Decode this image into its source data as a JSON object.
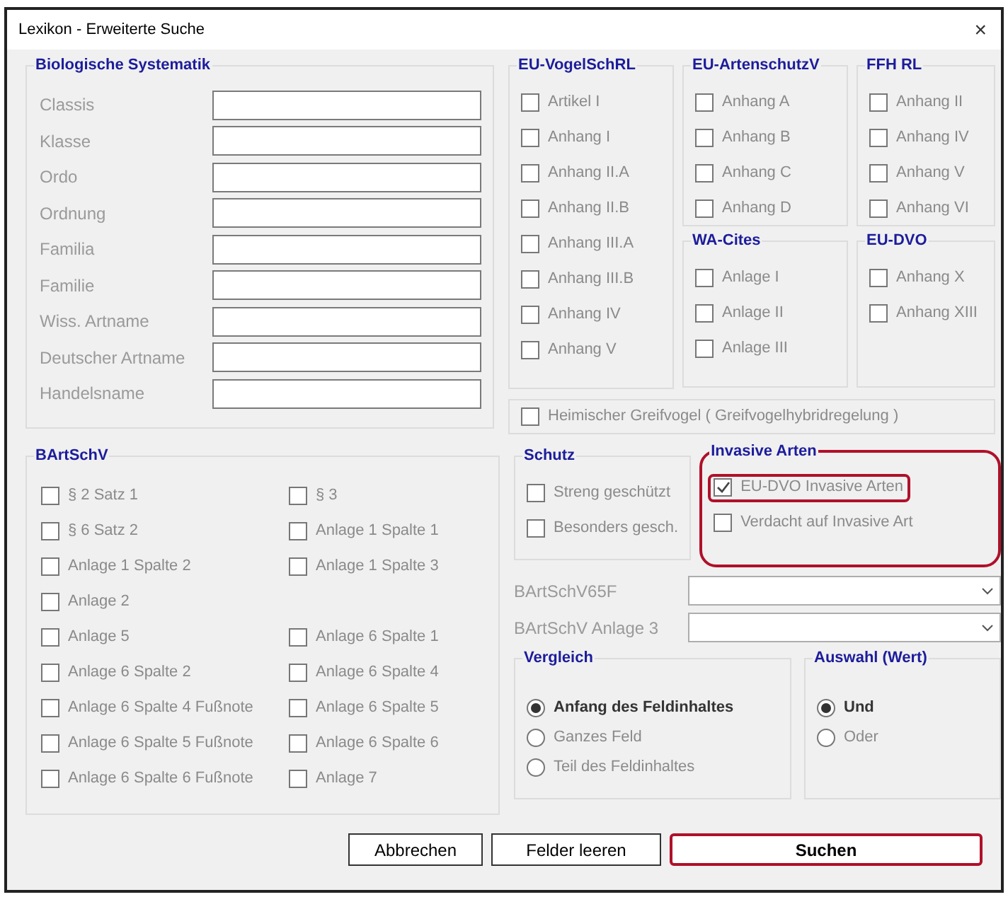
{
  "window": {
    "title": "Lexikon - Erweiterte Suche",
    "close": "×"
  },
  "biologische_systematik": {
    "title": "Biologische Systematik",
    "fields": [
      {
        "label": "Classis"
      },
      {
        "label": "Klasse"
      },
      {
        "label": "Ordo"
      },
      {
        "label": "Ordnung"
      },
      {
        "label": "Familia"
      },
      {
        "label": "Familie"
      },
      {
        "label": "Wiss. Artname"
      },
      {
        "label": "Deutscher Artname"
      },
      {
        "label": "Handelsname"
      }
    ]
  },
  "eu_vogelschrl": {
    "title": "EU-VogelSchRL",
    "items": [
      {
        "label": "Artikel I",
        "checked": false
      },
      {
        "label": "Anhang I",
        "checked": false
      },
      {
        "label": "Anhang II.A",
        "checked": false
      },
      {
        "label": "Anhang II.B",
        "checked": false
      },
      {
        "label": "Anhang III.A",
        "checked": false
      },
      {
        "label": "Anhang III.B",
        "checked": false
      },
      {
        "label": "Anhang IV",
        "checked": false
      },
      {
        "label": "Anhang V",
        "checked": false
      }
    ]
  },
  "eu_artenschutzv": {
    "title": "EU-ArtenschutzV",
    "items": [
      {
        "label": "Anhang A",
        "checked": false
      },
      {
        "label": "Anhang B",
        "checked": false
      },
      {
        "label": "Anhang C",
        "checked": false
      },
      {
        "label": "Anhang D",
        "checked": false
      }
    ]
  },
  "ffh_rl": {
    "title": "FFH RL",
    "items": [
      {
        "label": "Anhang II",
        "checked": false
      },
      {
        "label": "Anhang IV",
        "checked": false
      },
      {
        "label": "Anhang V",
        "checked": false
      },
      {
        "label": "Anhang VI",
        "checked": false
      }
    ]
  },
  "wa_cites": {
    "title": "WA-Cites",
    "items": [
      {
        "label": "Anlage I",
        "checked": false
      },
      {
        "label": "Anlage II",
        "checked": false
      },
      {
        "label": "Anlage III",
        "checked": false
      }
    ]
  },
  "eu_dvo": {
    "title": "EU-DVO",
    "items": [
      {
        "label": "Anhang X",
        "checked": false
      },
      {
        "label": "Anhang XIII",
        "checked": false
      }
    ]
  },
  "heimischer_greifvogel": {
    "label": "Heimischer Greifvogel  ( Greifvogelhybridregelung )",
    "checked": false
  },
  "bartschv": {
    "title": "BArtSchV",
    "rows": [
      {
        "left": {
          "label": "§ 2 Satz 1",
          "checked": false
        },
        "right": {
          "label": "§ 3",
          "checked": false
        }
      },
      {
        "left": {
          "label": "§ 6 Satz 2",
          "checked": false
        },
        "right": {
          "label": "Anlage 1 Spalte 1",
          "checked": false
        }
      },
      {
        "left": {
          "label": "Anlage 1 Spalte 2",
          "checked": false
        },
        "right": {
          "label": "Anlage 1 Spalte 3",
          "checked": false
        }
      },
      {
        "left": {
          "label": "Anlage 2",
          "checked": false
        }
      },
      {
        "left": {
          "label": "Anlage 5",
          "checked": false
        },
        "right": {
          "label": "Anlage 6 Spalte 1",
          "checked": false
        }
      },
      {
        "left": {
          "label": "Anlage 6 Spalte 2",
          "checked": false
        },
        "right": {
          "label": "Anlage 6 Spalte 4",
          "checked": false
        }
      },
      {
        "left": {
          "label": "Anlage 6 Spalte 4 Fußnote",
          "checked": false
        },
        "right": {
          "label": "Anlage 6 Spalte 5",
          "checked": false
        }
      },
      {
        "left": {
          "label": "Anlage 6 Spalte 5 Fußnote",
          "checked": false
        },
        "right": {
          "label": "Anlage 6 Spalte 6",
          "checked": false
        }
      },
      {
        "left": {
          "label": "Anlage 6 Spalte 6 Fußnote",
          "checked": false
        },
        "right": {
          "label": "Anlage 7",
          "checked": false
        }
      }
    ]
  },
  "schutz": {
    "title": "Schutz",
    "items": [
      {
        "label": "Streng geschützt",
        "checked": false
      },
      {
        "label": "Besonders gesch.",
        "checked": false
      }
    ]
  },
  "invasive_arten": {
    "title": "Invasive Arten",
    "highlighted": true,
    "items": [
      {
        "label": "EU-DVO Invasive Arten",
        "checked": true,
        "highlighted": true
      },
      {
        "label": "Verdacht auf  Invasive Art",
        "checked": false,
        "highlighted": false
      }
    ]
  },
  "dropdowns": [
    {
      "label": "BArtSchV65F"
    },
    {
      "label": "BArtSchV Anlage 3"
    }
  ],
  "vergleich": {
    "title": "Vergleich",
    "options": [
      {
        "label": "Anfang des Feldinhaltes",
        "selected": true
      },
      {
        "label": "Ganzes Feld",
        "selected": false
      },
      {
        "label": "Teil des Feldinhaltes",
        "selected": false
      }
    ]
  },
  "auswahl": {
    "title": "Auswahl (Wert)",
    "options": [
      {
        "label": "Und",
        "selected": true
      },
      {
        "label": "Oder",
        "selected": false
      }
    ]
  },
  "buttons": [
    {
      "label": "Abbrechen",
      "highlighted": false
    },
    {
      "label": "Felder leeren",
      "highlighted": false
    },
    {
      "label": "Suchen",
      "highlighted": true
    }
  ]
}
